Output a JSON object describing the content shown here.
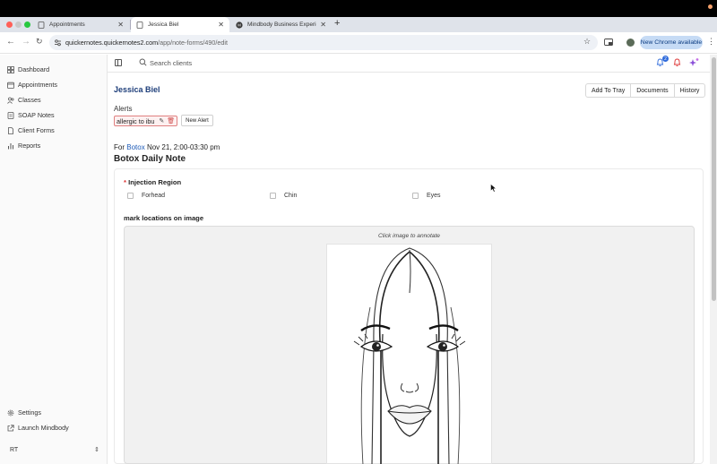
{
  "browser": {
    "tabs": [
      {
        "label": "Appointments"
      },
      {
        "label": "Jessica Biel"
      },
      {
        "label": "Mindbody Business Experien"
      }
    ],
    "url_host": "quickernotes.quickernotes2.com",
    "url_path": "/app/note-forms/490/edit",
    "new_chrome_label": "New Chrome available"
  },
  "sidebar": {
    "items": [
      {
        "label": "Dashboard",
        "icon": "dashboard-icon"
      },
      {
        "label": "Appointments",
        "icon": "calendar-icon"
      },
      {
        "label": "Classes",
        "icon": "users-icon"
      },
      {
        "label": "SOAP Notes",
        "icon": "soap-notes-icon"
      },
      {
        "label": "Client Forms",
        "icon": "forms-icon"
      },
      {
        "label": "Reports",
        "icon": "chart-icon"
      }
    ],
    "bottom": [
      {
        "label": "Settings",
        "icon": "gear-icon"
      },
      {
        "label": "Launch Mindbody",
        "icon": "launch-icon"
      }
    ],
    "user_initials": "RT"
  },
  "header": {
    "search_placeholder": "Search clients",
    "notification_count": "2"
  },
  "client": {
    "name": "Jessica Biel",
    "actions": [
      "Add To Tray",
      "Documents",
      "History"
    ]
  },
  "alerts": {
    "label": "Alerts",
    "chip_text": "allergic to ibu",
    "new_alert_label": "New Alert"
  },
  "note": {
    "for_prefix": "For",
    "service": "Botox",
    "datetime": "Nov 21, 2:00-03:30 pm",
    "title": "Botox Daily Note"
  },
  "form": {
    "injection_label": "Injection Region",
    "required_mark": "*",
    "regions": [
      {
        "label": "Forhead",
        "checked": false
      },
      {
        "label": "Chin",
        "checked": false
      },
      {
        "label": "Eyes",
        "checked": false
      }
    ],
    "mark_label": "mark locations on image",
    "click_hint": "Click image to annotate"
  }
}
